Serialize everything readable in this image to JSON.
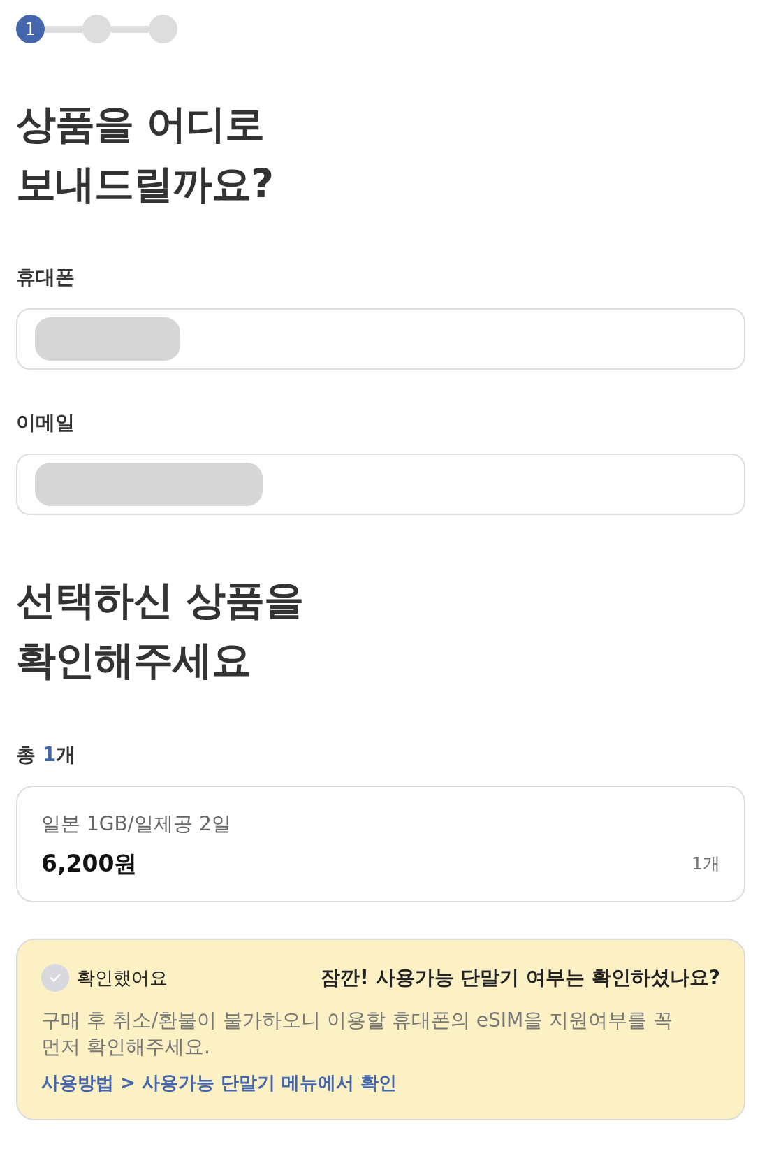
{
  "stepper": {
    "steps": [
      {
        "label": "1",
        "selected": true
      },
      {
        "selected": false
      },
      {
        "selected": false
      }
    ]
  },
  "delivery": {
    "title": "상품을 어디로\n보내드릴까요?",
    "fields": [
      {
        "label": "휴대폰",
        "value_redacted": true
      },
      {
        "label": "이메일",
        "value_redacted": true
      }
    ]
  },
  "order": {
    "title": "선택하신 상품을\n확인해주세요",
    "total_label": "총",
    "total_count": "1",
    "total_unit": "개",
    "items": [
      {
        "name": "일본 1GB/일제공 2일",
        "price": "6,200원",
        "quantity": "1개"
      }
    ]
  },
  "notice": {
    "checkbox": {
      "label": "확인했어요",
      "checked": false
    },
    "title": "잠깐! 사용가능 단말기 여부는 확인하셨나요?",
    "message": "구매 후 취소/환불이 불가하오니 이용할 휴대폰의 eSIM을 지원여부를 꼭 먼저 확인해주세요.",
    "link": "사용방법 > 사용가능 단말기 메뉴에서 확인"
  }
}
